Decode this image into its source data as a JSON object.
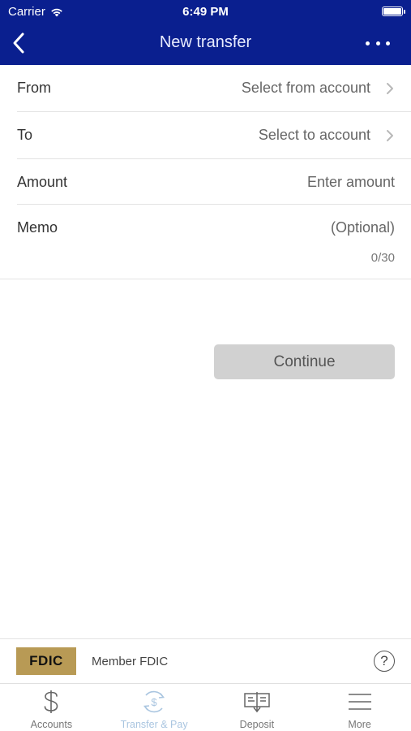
{
  "status_bar": {
    "carrier": "Carrier",
    "time": "6:49 PM"
  },
  "nav": {
    "title": "New transfer",
    "back_icon": "chevron-left-icon",
    "more_icon": "ellipsis-icon"
  },
  "form": {
    "from": {
      "label": "From",
      "value": "Select from account"
    },
    "to": {
      "label": "To",
      "value": "Select to account"
    },
    "amount": {
      "label": "Amount",
      "placeholder": "Enter amount"
    },
    "memo": {
      "label": "Memo",
      "placeholder": "(Optional)",
      "counter": "0/30"
    },
    "continue_label": "Continue"
  },
  "footer": {
    "fdic_logo": "FDIC",
    "member_text": "Member FDIC",
    "help_label": "?"
  },
  "tabs": [
    {
      "label": "Accounts",
      "icon": "dollar-icon",
      "active": false
    },
    {
      "label": "Transfer & Pay",
      "icon": "transfer-pay-icon",
      "active": true
    },
    {
      "label": "Deposit",
      "icon": "check-deposit-icon",
      "active": false
    },
    {
      "label": "More",
      "icon": "menu-icon",
      "active": false
    }
  ],
  "colors": {
    "header": "#0a1f8f",
    "active_tab": "#a9c5e0",
    "button_disabled": "#d1d1d1"
  }
}
